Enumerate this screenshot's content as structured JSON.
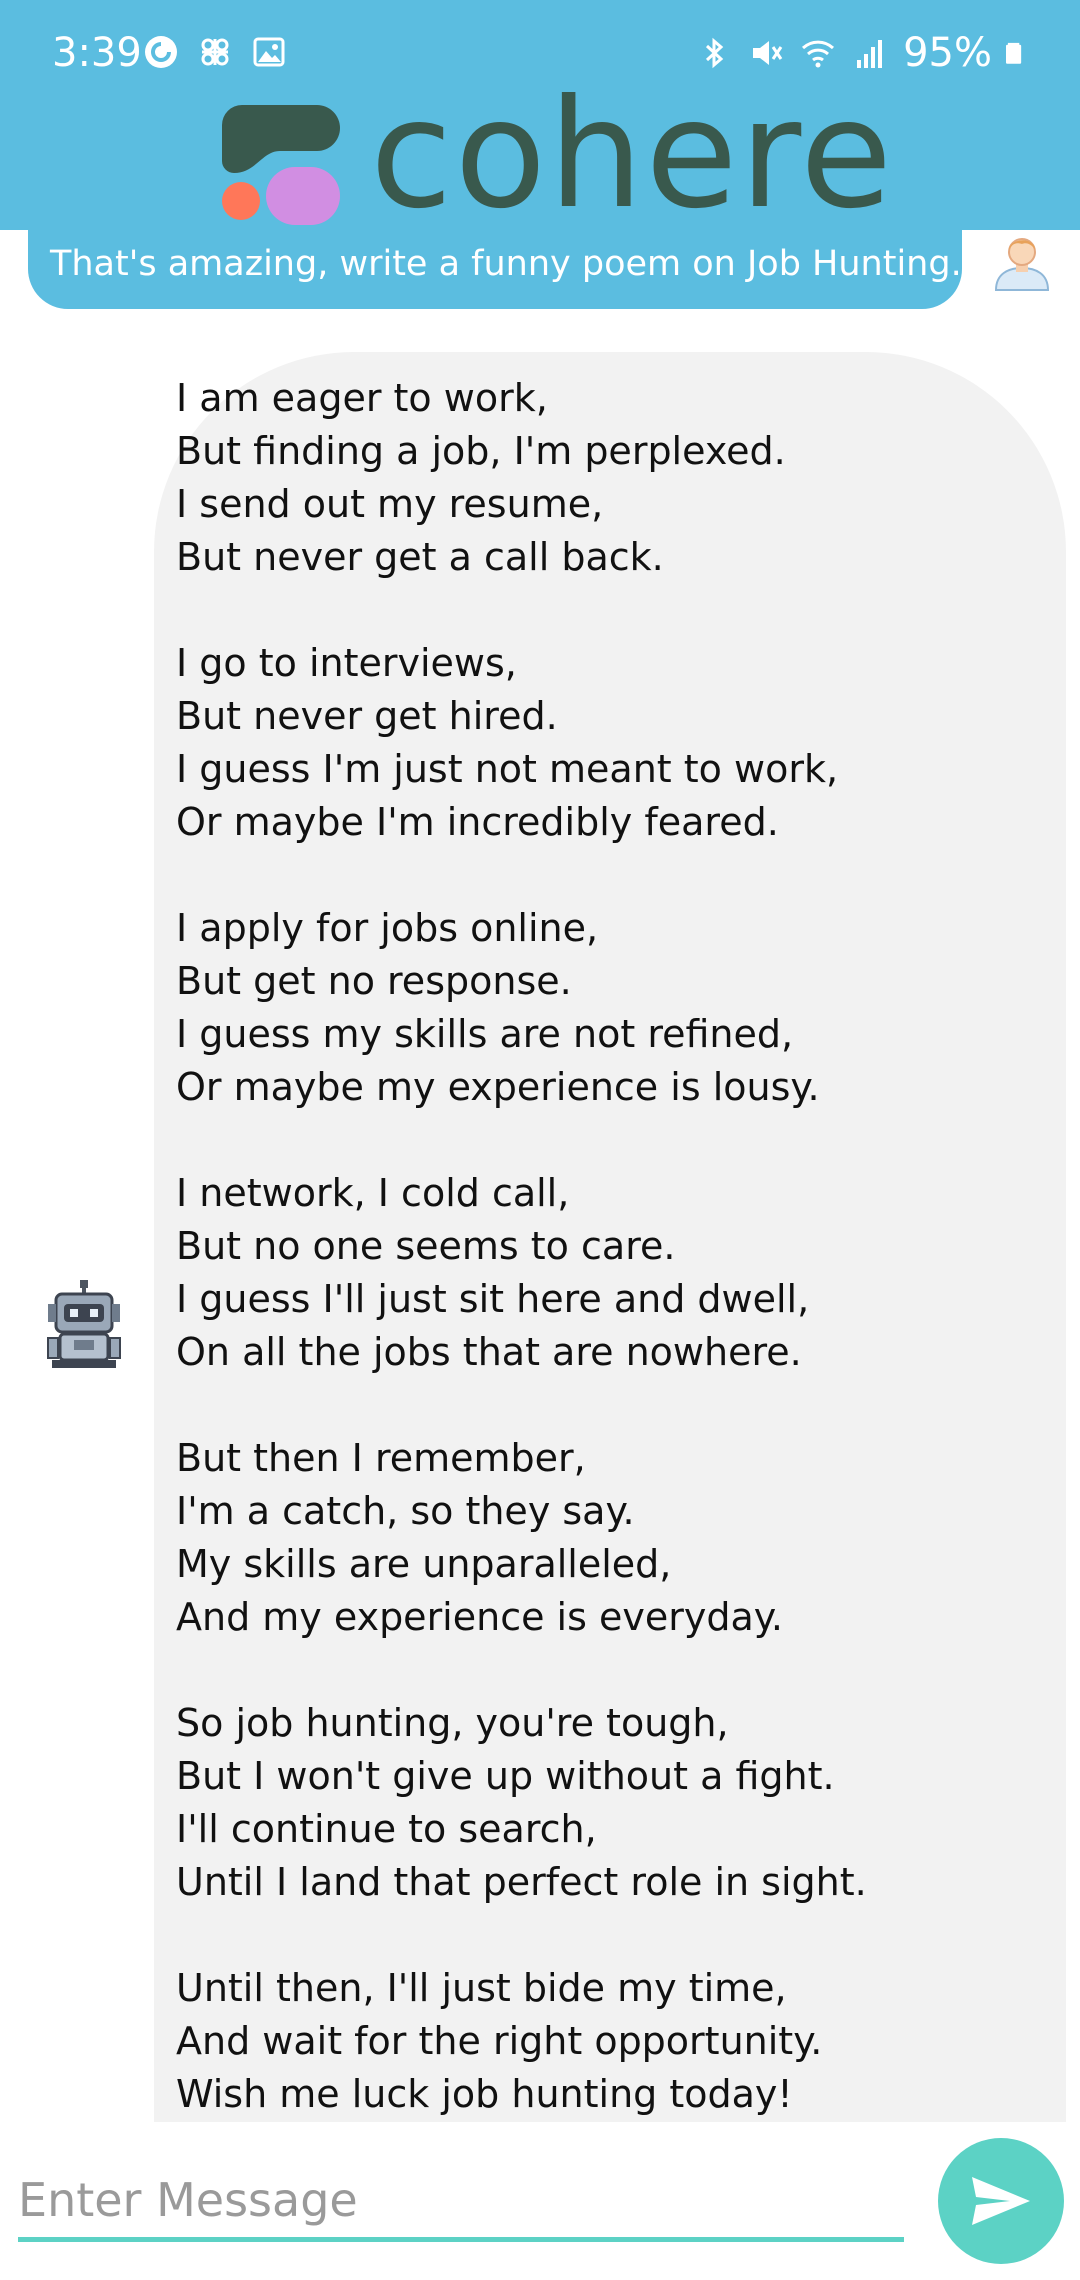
{
  "status_bar": {
    "time": "3:39",
    "battery": "95%",
    "left_icons": [
      "pocket-casts-icon",
      "app-notification-icon",
      "gallery-icon"
    ],
    "right_icons": [
      "bluetooth-icon",
      "mute-icon",
      "wifi-icon",
      "cellular-signal-icon",
      "battery-icon"
    ]
  },
  "header": {
    "logo_text": "cohere",
    "logo_color": "#39594d",
    "background": "#5bbde0"
  },
  "messages": {
    "user": {
      "text": "That's amazing, write a funny poem on Job Hunting.",
      "avatar_icon": "user-avatar-icon"
    },
    "bot": {
      "avatar_icon": "robot-avatar-icon",
      "stanzas": [
        [
          "I am eager to work,",
          "But finding a job, I'm perplexed.",
          "I send out my resume,",
          "But never get a call back."
        ],
        [
          "I go to interviews,",
          "But never get hired.",
          "I guess I'm just not meant to work,",
          "Or maybe I'm incredibly feared."
        ],
        [
          "I apply for jobs online,",
          "But get no response.",
          "I guess my skills are not refined,",
          "Or maybe my experience is lousy."
        ],
        [
          "I network, I cold call,",
          "But no one seems to care.",
          "I guess I'll just sit here and dwell,",
          "On all the jobs that are nowhere."
        ],
        [
          "But then I remember,",
          "I'm a catch, so they say.",
          "My skills are unparalleled,",
          "And my experience is everyday."
        ],
        [
          "So job hunting, you're tough,",
          "But I won't give up without a fight.",
          "I'll continue to search,",
          "Until I land that perfect role in sight."
        ],
        [
          "Until then, I'll just bide my time,",
          "And wait for the right opportunity.",
          "Wish me luck job hunting today!"
        ]
      ]
    }
  },
  "composer": {
    "placeholder": "Enter Message",
    "value": "",
    "send_icon": "send-icon",
    "accent_color": "#5cd2c5"
  }
}
